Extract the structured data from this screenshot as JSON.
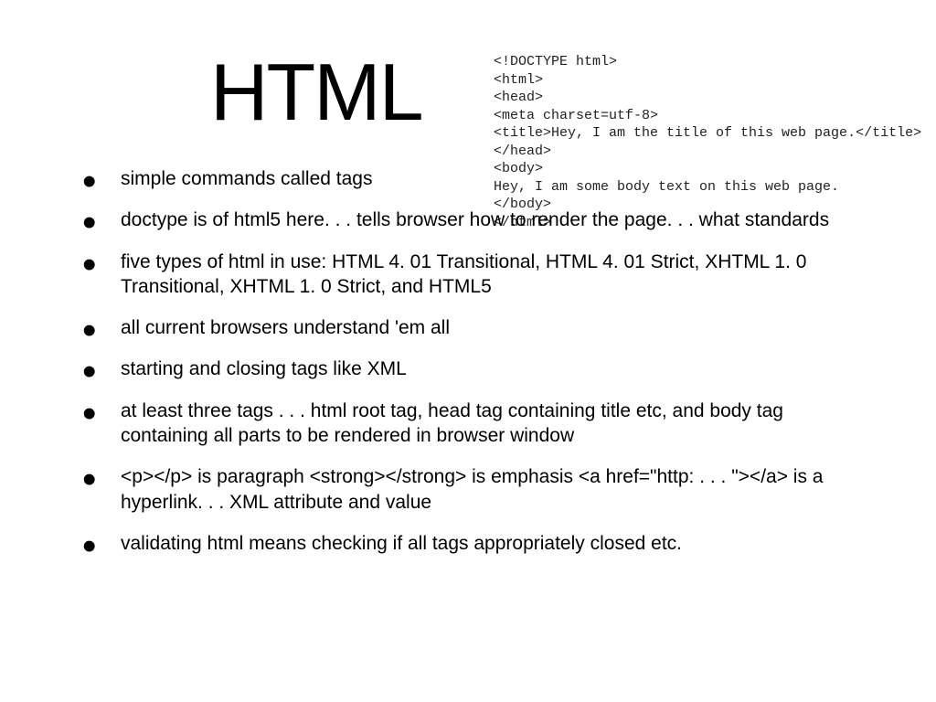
{
  "title": "HTML",
  "code_sample": "<!DOCTYPE html>\n<html>\n<head>\n<meta charset=utf-8>\n<title>Hey, I am the title of this web page.</title>\n</head>\n<body>\nHey, I am some body text on this web page.\n</body>\n</html>",
  "bullets": [
    "simple commands called tags",
    "doctype is of html5 here. . . tells browser how to render the page. . . what standards",
    "five types of html in use: HTML 4. 01 Transitional, HTML 4. 01 Strict, XHTML 1. 0 Transitional, XHTML 1. 0 Strict, and HTML5",
    "all current browsers understand 'em all",
    "starting and closing tags like XML",
    "at least three tags . . . html root tag, head tag containing title etc, and body tag containing all parts to be rendered in browser window",
    "<p></p> is paragraph <strong></strong> is emphasis <a href=\"http: . . . \"></a> is a hyperlink. . . XML attribute and value",
    "validating html means checking if all tags appropriately closed etc."
  ]
}
